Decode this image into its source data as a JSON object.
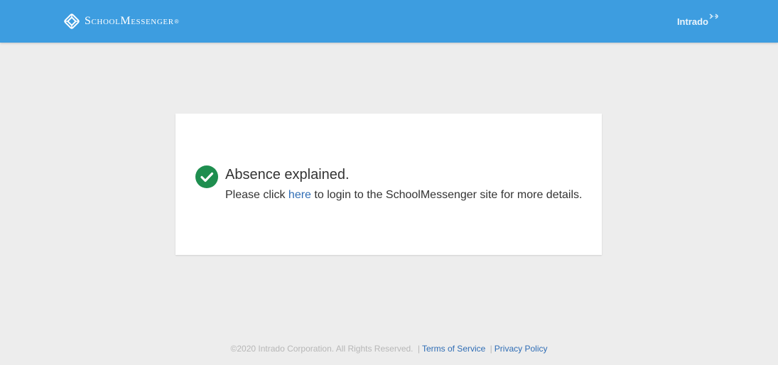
{
  "header": {
    "brand": "SchoolMessenger",
    "brand_reg": "®",
    "partner": "Intrado",
    "colors": {
      "bar": "#3d9de0"
    },
    "icons": {
      "logo": "schoolmessenger-logo-icon",
      "partner_mark": "intrado-signal-icon"
    }
  },
  "message": {
    "title": "Absence explained.",
    "body_prefix": "Please click ",
    "link_text": "here",
    "body_suffix": " to login to the SchoolMessenger site for more details.",
    "icon": "check-circle-icon",
    "icon_color": "#1e8e4f"
  },
  "footer": {
    "copyright": "©2020 Intrado Corporation. All Rights Reserved.",
    "separator": "|",
    "terms": "Terms of Service",
    "privacy": "Privacy Policy"
  }
}
